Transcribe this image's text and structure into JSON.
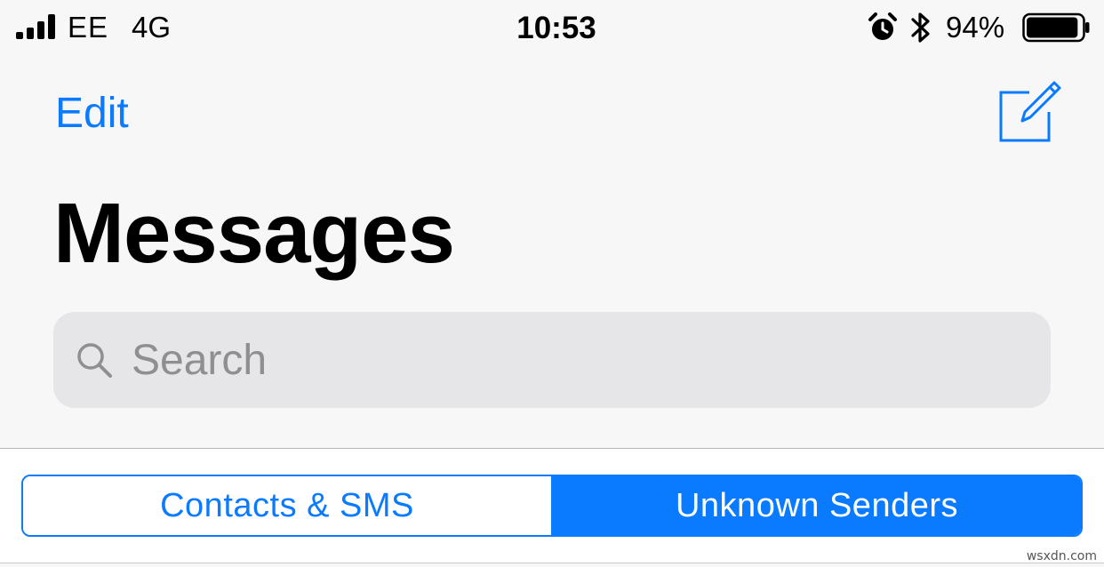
{
  "status_bar": {
    "carrier": "EE",
    "network": "4G",
    "time": "10:53",
    "battery_percent": "94%",
    "battery_level": 0.94,
    "signal_icon": "signal-bars-icon",
    "alarm_icon": "alarm-clock-icon",
    "bluetooth_icon": "bluetooth-icon",
    "battery_icon": "battery-icon"
  },
  "nav": {
    "edit_label": "Edit",
    "compose_icon": "compose-icon"
  },
  "header": {
    "title": "Messages"
  },
  "search": {
    "placeholder": "Search",
    "value": "",
    "icon": "search-icon"
  },
  "filter": {
    "segments": [
      {
        "label": "Contacts & SMS",
        "selected": false
      },
      {
        "label": "Unknown Senders",
        "selected": true
      }
    ]
  },
  "watermark": "wsxdn.com",
  "colors": {
    "accent": "#0a7bff",
    "background": "#f7f7f7",
    "search_bg": "#e6e6e8",
    "placeholder": "#8e8e93"
  }
}
